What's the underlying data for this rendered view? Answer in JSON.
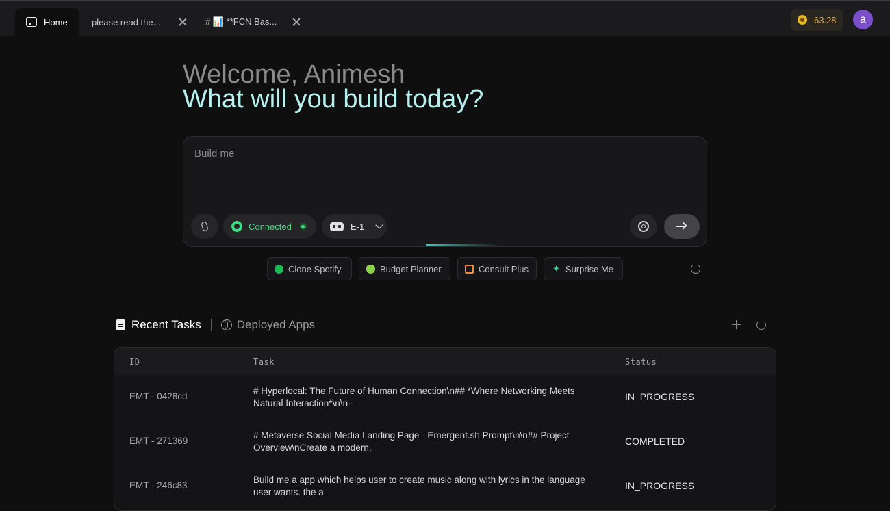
{
  "tabs": {
    "home": "Home",
    "tab1": "please read the...",
    "tab2": "# 📊 **FCN Bas..."
  },
  "credits": "63.28",
  "avatar_initial": "a",
  "hero": {
    "welcome": "Welcome, Animesh",
    "headline": "What will you build today?"
  },
  "prompt": {
    "placeholder": "Build me",
    "connected_label": "Connected",
    "model_label": "E-1"
  },
  "suggestions": [
    {
      "label": "Clone Spotify",
      "icon": "spotify-icon"
    },
    {
      "label": "Budget Planner",
      "icon": "piggy-bank-icon"
    },
    {
      "label": "Consult Plus",
      "icon": "calendar-icon"
    },
    {
      "label": "Surprise Me",
      "icon": "sparkle-icon"
    }
  ],
  "section_tabs": {
    "recent": "Recent Tasks",
    "deployed": "Deployed Apps"
  },
  "table": {
    "headers": {
      "id": "ID",
      "task": "Task",
      "status": "Status"
    },
    "rows": [
      {
        "id": "EMT - 0428cd",
        "task": "# Hyperlocal: The Future of Human Connection\\n## *Where Networking Meets Natural Interaction*\\n\\n--",
        "status": "IN_PROGRESS"
      },
      {
        "id": "EMT - 271369",
        "task": "# Metaverse Social Media Landing Page - Emergent.sh Prompt\\n\\n## Project Overview\\nCreate a modern,",
        "status": "COMPLETED"
      },
      {
        "id": "EMT - 246c83",
        "task": "Build me a app which helps user to create music along with lyrics in the language user wants. the a",
        "status": "IN_PROGRESS"
      }
    ]
  }
}
